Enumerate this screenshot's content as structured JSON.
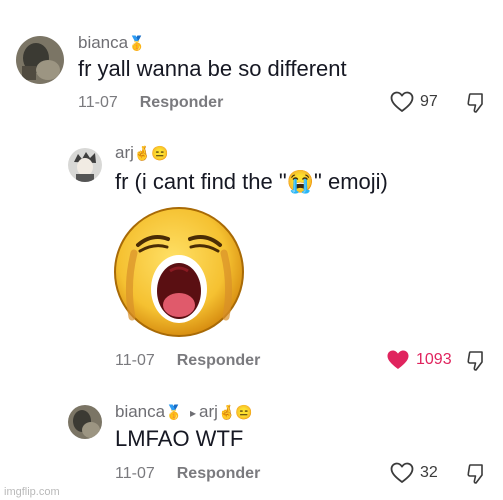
{
  "comments": [
    {
      "username": "bianca",
      "badges": [
        "🥇"
      ],
      "text": "fr yall wanna be so different",
      "date": "11-07",
      "reply_label": "Responder",
      "likes": "97",
      "liked": false
    },
    {
      "username": "arj",
      "badges": [
        "🤞",
        "😑"
      ],
      "text": "fr (i cant find the \"😭\" emoji)",
      "date": "11-07",
      "reply_label": "Responder",
      "likes": "1093",
      "liked": true,
      "sticker": "crying-face-sticker"
    },
    {
      "username": "bianca",
      "badges": [
        "🥇"
      ],
      "reply_to_arrow": "▸",
      "reply_to_user": "arj",
      "reply_to_badges": [
        "🤞",
        "😑"
      ],
      "text": "LMFAO WTF",
      "date": "11-07",
      "reply_label": "Responder",
      "likes": "32",
      "liked": false
    }
  ],
  "colors": {
    "liked": "#e0245e",
    "muted": "#7a7a7e"
  },
  "watermark": "imgflip.com"
}
